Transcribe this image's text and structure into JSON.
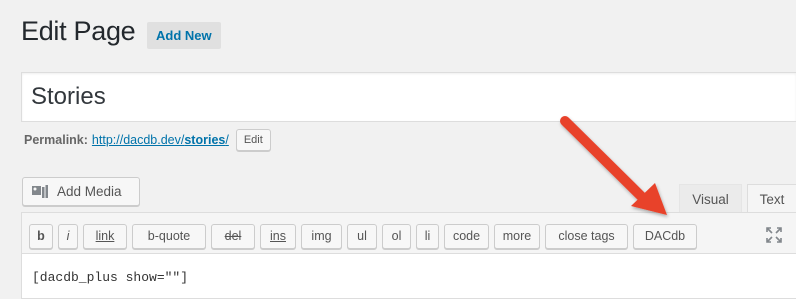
{
  "header": {
    "title": "Edit Page",
    "add_new_label": "Add New"
  },
  "post": {
    "title_value": "Stories"
  },
  "permalink": {
    "label": "Permalink:",
    "url_prefix": "http://dacdb.dev/",
    "url_slug": "stories",
    "url_suffix": "/",
    "edit_label": "Edit"
  },
  "media": {
    "add_media_label": "Add Media",
    "icon": "add-media-icon"
  },
  "tabs": {
    "visual_label": "Visual",
    "text_label": "Text",
    "active": "Text"
  },
  "quicktags": [
    {
      "label": "b"
    },
    {
      "label": "i"
    },
    {
      "label": "link"
    },
    {
      "label": "b-quote"
    },
    {
      "label": "del"
    },
    {
      "label": "ins"
    },
    {
      "label": "img"
    },
    {
      "label": "ul"
    },
    {
      "label": "ol"
    },
    {
      "label": "li"
    },
    {
      "label": "code"
    },
    {
      "label": "more"
    },
    {
      "label": "close tags"
    },
    {
      "label": "DACdb"
    }
  ],
  "toolbar": {
    "fullscreen_icon": "fullscreen-icon"
  },
  "editor": {
    "content": "[dacdb_plus show=\"\"]"
  },
  "annotation": {
    "arrow_color": "#e8432b",
    "points_to": "DACdb"
  },
  "colors": {
    "link": "#0073aa",
    "background": "#f1f1f1"
  }
}
